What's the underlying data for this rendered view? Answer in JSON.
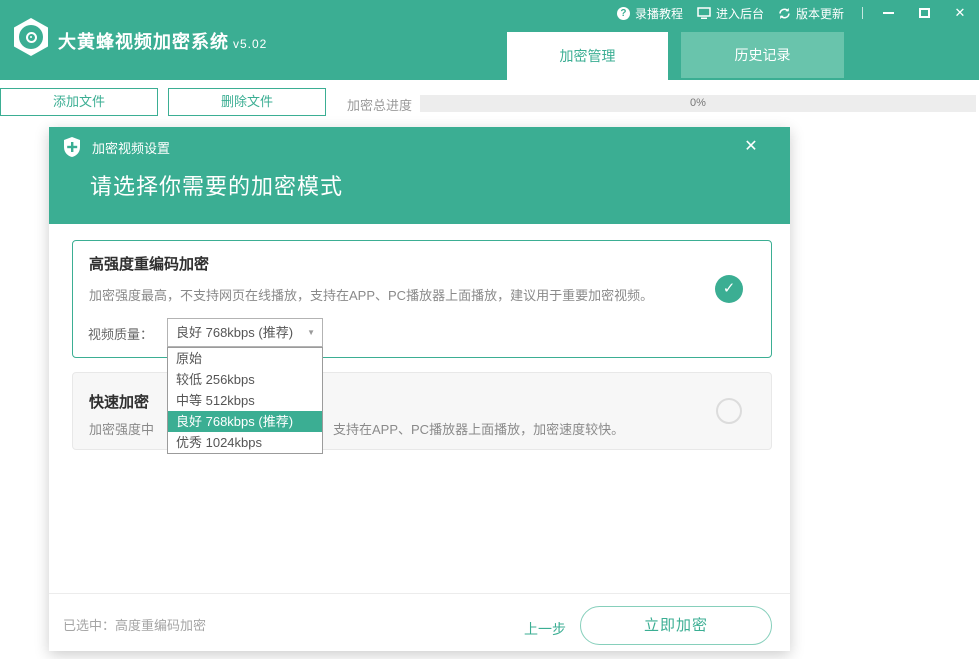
{
  "colors": {
    "brand": "#3bae93",
    "tab_inactive": "#69c4ac",
    "dropdown_highlight": "#3bae93"
  },
  "icons": {
    "help": "?",
    "close": "✕",
    "dialog_close": "✕",
    "check": "✓",
    "dropdown_arrow": "▼"
  },
  "titlebar": {
    "app_title": "大黄蜂视频加密系统",
    "version": "v5.02",
    "links": [
      {
        "label": "录播教程"
      },
      {
        "label": "进入后台"
      },
      {
        "label": "版本更新"
      }
    ]
  },
  "tabs": [
    {
      "label": "加密管理",
      "active": true
    },
    {
      "label": "历史记录",
      "active": false
    }
  ],
  "toolbar": {
    "add_label": "添加文件",
    "delete_label": "删除文件",
    "progress_label": "加密总进度",
    "progress_value": "0%"
  },
  "dialog": {
    "title": "加密视频设置",
    "heading": "请选择你需要的加密模式",
    "option_strong": {
      "title": "高强度重编码加密",
      "description": "加密强度最高，不支持网页在线播放，支持在APP、PC播放器上面播放，建议用于重要加密视频。",
      "quality_label": "视频质量：",
      "quality_value": "良好 768kbps (推荐)"
    },
    "option_fast": {
      "title": "快速加密",
      "description_left": "加密强度中",
      "description_right": "支持在APP、PC播放器上面播放，加密速度较快。"
    },
    "dropdown": {
      "options": [
        "原始",
        "较低 256kbps",
        "中等 512kbps",
        "良好 768kbps (推荐)",
        "优秀 1024kbps"
      ],
      "highlighted": "良好 768kbps (推荐)"
    },
    "footer": {
      "selected_text": "已选中：高度重编码加密",
      "back_label": "上一步",
      "encrypt_label": "立即加密"
    }
  }
}
